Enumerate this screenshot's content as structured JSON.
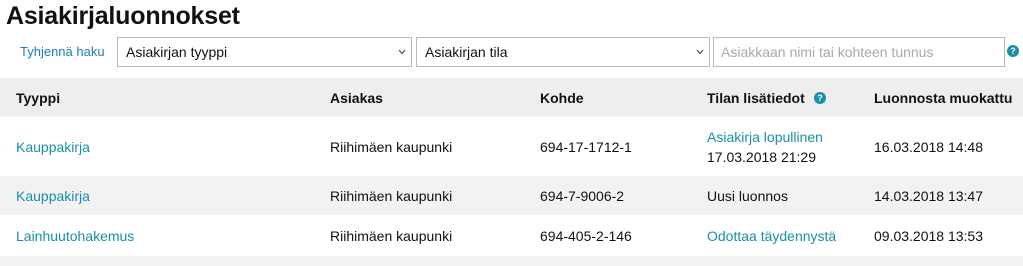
{
  "page": {
    "title": "Asiakirjaluonnokset"
  },
  "filters": {
    "clear_label": "Tyhjennä haku",
    "type_select": "Asiakirjan tyyppi",
    "state_select": "Asiakirjan tila",
    "search_placeholder": "Asiakkaan nimi tai kohteen tunnus",
    "search_value": "",
    "help_icon": "?"
  },
  "table": {
    "headers": {
      "type": "Tyyppi",
      "customer": "Asiakas",
      "target": "Kohde",
      "state_info": "Tilan lisätiedot",
      "modified": "Luonnosta muokattu"
    },
    "rows": [
      {
        "type": "Kauppakirja",
        "customer": "Riihimäen kaupunki",
        "target": "694-17-1712-1",
        "state_link": "Asiakirja lopullinen",
        "state_text": "17.03.2018 21:29",
        "modified": "16.03.2018 14:48"
      },
      {
        "type": "Kauppakirja",
        "customer": "Riihimäen kaupunki",
        "target": "694-7-9006-2",
        "state_text": "Uusi luonnos",
        "modified": "14.03.2018 13:47"
      },
      {
        "type": "Lainhuutohakemus",
        "customer": "Riihimäen kaupunki",
        "target": "694-405-2-146",
        "state_link": "Odottaa täydennystä",
        "modified": "09.03.2018 13:53"
      }
    ]
  },
  "colors": {
    "link": "#1a8fa8",
    "header_bg": "#eeeeee",
    "stripe_bg": "#f2f2f2"
  },
  "icons": [
    "chevron-down-icon",
    "help-icon"
  ]
}
